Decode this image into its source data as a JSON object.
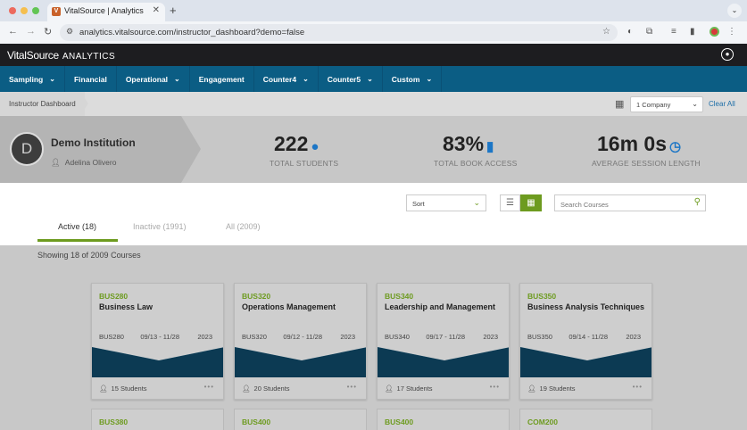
{
  "browser": {
    "tab_title": "VitalSource | Analytics",
    "tab_favicon": "V",
    "url": "analytics.vitalsource.com/instructor_dashboard?demo=false"
  },
  "header": {
    "brand": "VitalSource",
    "product": "ANALYTICS"
  },
  "nav": {
    "items": [
      {
        "label": "Sampling",
        "dropdown": true
      },
      {
        "label": "Financial",
        "dropdown": false
      },
      {
        "label": "Operational",
        "dropdown": true
      },
      {
        "label": "Engagement",
        "dropdown": false
      },
      {
        "label": "Counter4",
        "dropdown": true
      },
      {
        "label": "Counter5",
        "dropdown": true
      },
      {
        "label": "Custom",
        "dropdown": true
      }
    ]
  },
  "breadcrumb": {
    "current": "Instructor Dashboard",
    "company_select": "1 Company",
    "clear_all": "Clear All"
  },
  "institution": {
    "avatar_letter": "D",
    "name": "Demo Institution",
    "user": "Adelina Olivero"
  },
  "stats": {
    "students": {
      "value": "222",
      "label": "TOTAL STUDENTS",
      "icon": "person-icon"
    },
    "book_access": {
      "value": "83%",
      "label": "TOTAL BOOK ACCESS",
      "icon": "book-icon"
    },
    "session": {
      "value": "16m 0s",
      "label": "AVERAGE SESSION LENGTH",
      "icon": "stopwatch-icon"
    }
  },
  "filters": {
    "sort_label": "Sort",
    "search_placeholder": "Search Courses",
    "tabs": [
      {
        "label": "Active (18)",
        "active": true
      },
      {
        "label": "Inactive (1991)",
        "active": false
      },
      {
        "label": "All (2009)",
        "active": false
      }
    ]
  },
  "showing_text": "Showing 18 of 2009 Courses",
  "courses": [
    {
      "code": "BUS280",
      "title": "Business Law",
      "meta_code": "BUS280",
      "dates": "09/13 - 11/28",
      "year": "2023",
      "students": "15 Students"
    },
    {
      "code": "BUS320",
      "title": "Operations Management",
      "meta_code": "BUS320",
      "dates": "09/12 - 11/28",
      "year": "2023",
      "students": "20 Students"
    },
    {
      "code": "BUS340",
      "title": "Leadership and Management",
      "meta_code": "BUS340",
      "dates": "09/17 - 11/28",
      "year": "2023",
      "students": "17 Students"
    },
    {
      "code": "BUS350",
      "title": "Business Analysis Techniques",
      "meta_code": "BUS350",
      "dates": "09/14 - 11/28",
      "year": "2023",
      "students": "19 Students"
    }
  ],
  "courses_next_row": [
    {
      "code": "BUS380"
    },
    {
      "code": "BUS400"
    },
    {
      "code": "BUS400"
    },
    {
      "code": "COM200"
    }
  ],
  "colors": {
    "nav_bg": "#0b5d84",
    "accent_green": "#6d9b1f",
    "card_art_dark": "#0c3a53",
    "card_art_mid": "#155f86"
  }
}
